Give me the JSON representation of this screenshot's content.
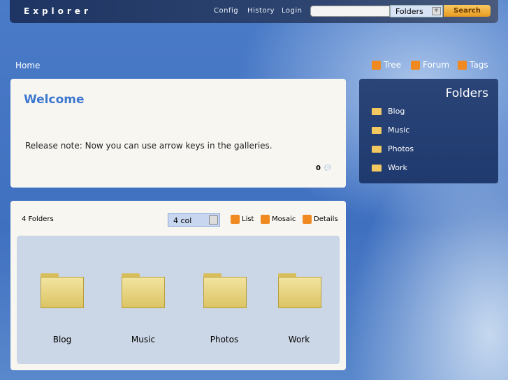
{
  "header": {
    "logo": "Explorer",
    "nav": [
      "Config",
      "History",
      "Login"
    ],
    "search_value": "",
    "search_scope": "Folders",
    "search_button": "Search"
  },
  "breadcrumb": "Home",
  "toplinks": [
    {
      "label": "Tree",
      "icon": "tree-icon"
    },
    {
      "label": "Forum",
      "icon": "forum-icon"
    },
    {
      "label": "Tags",
      "icon": "tags-icon"
    }
  ],
  "welcome": {
    "title": "Welcome",
    "note": "Release note: Now you can use arrow keys in the galleries.",
    "comment_count": "0"
  },
  "sidebar": {
    "title": "Folders",
    "items": [
      "Blog",
      "Music",
      "Photos",
      "Work"
    ]
  },
  "folders": {
    "count_label": "4 Folders",
    "columns": "4 col",
    "views": [
      "List",
      "Mosaic",
      "Details"
    ],
    "items": [
      "Blog",
      "Music",
      "Photos",
      "Work"
    ]
  },
  "colors": {
    "accent": "#3c78d0",
    "orange": "#f08a20"
  }
}
